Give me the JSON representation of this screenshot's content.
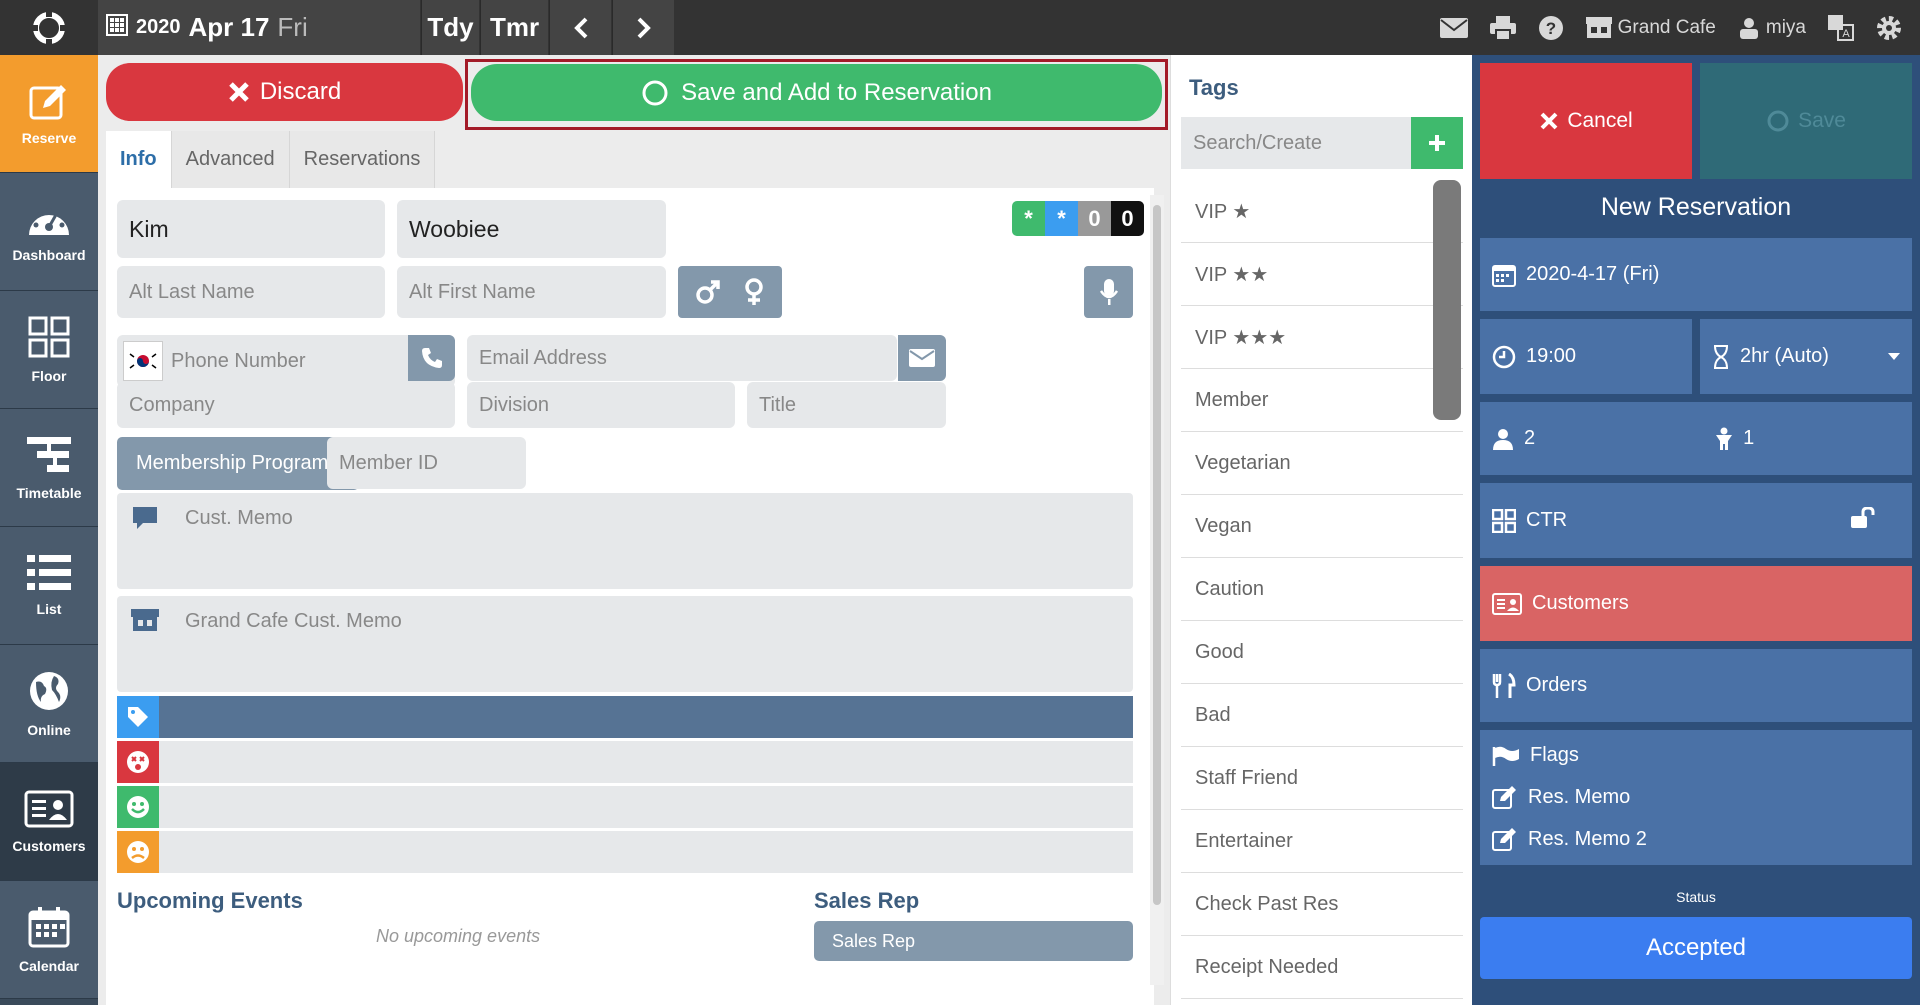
{
  "topbar": {
    "year": "2020",
    "month_day": "Apr 17",
    "weekday": "Fri",
    "today_label": "Tdy",
    "tomorrow_label": "Tmr",
    "restaurant": "Grand Cafe",
    "user": "miya"
  },
  "sidebar": {
    "items": [
      {
        "label": "Reserve",
        "icon": "edit-icon"
      },
      {
        "label": "Dashboard",
        "icon": "dashboard-icon"
      },
      {
        "label": "Floor",
        "icon": "floor-icon"
      },
      {
        "label": "Timetable",
        "icon": "timetable-icon"
      },
      {
        "label": "List",
        "icon": "list-icon"
      },
      {
        "label": "Online",
        "icon": "globe-icon"
      },
      {
        "label": "Customers",
        "icon": "customers-icon"
      },
      {
        "label": "Calendar",
        "icon": "calendar-icon"
      }
    ]
  },
  "actions": {
    "discard": "Discard",
    "save_add": "Save and Add to Reservation"
  },
  "tabs": [
    "Info",
    "Advanced",
    "Reservations"
  ],
  "form": {
    "last_name": "Kim",
    "first_name": "Woobiee",
    "alt_last_name": "Alt Last Name",
    "alt_first_name": "Alt First Name",
    "phone": "Phone Number",
    "email": "Email Address",
    "company": "Company",
    "division": "Division",
    "title": "Title",
    "membership_program": "Membership Program",
    "member_id": "Member ID",
    "cust_memo": "Cust. Memo",
    "venue_cust_memo": "Grand Cafe Cust. Memo",
    "badges": [
      "*",
      "*",
      "0",
      "0"
    ],
    "upcoming_events_title": "Upcoming Events",
    "no_upcoming": "No upcoming events",
    "sales_rep_title": "Sales Rep",
    "sales_rep_placeholder": "Sales Rep"
  },
  "tags": {
    "title": "Tags",
    "search_placeholder": "Search/Create",
    "items": [
      "VIP ★",
      "VIP ★★",
      "VIP ★★★",
      "Member",
      "Vegetarian",
      "Vegan",
      "Caution",
      "Good",
      "Bad",
      "Staff Friend",
      "Entertainer",
      "Check Past Res",
      "Receipt Needed"
    ]
  },
  "reservation": {
    "cancel": "Cancel",
    "save": "Save",
    "title": "New Reservation",
    "date": "2020-4-17 (Fri)",
    "time": "19:00",
    "duration": "2hr (Auto)",
    "adults": "2",
    "children": "1",
    "table": "CTR",
    "customers": "Customers",
    "orders": "Orders",
    "flags": "Flags",
    "res_memo": "Res. Memo",
    "res_memo2": "Res. Memo 2",
    "status_label": "Status",
    "status": "Accepted"
  },
  "colors": {
    "discard": "#d9373f",
    "save_add": "#3fba6d",
    "accent_orange": "#f39c2d",
    "right_panel": "#2e4f7a",
    "accepted": "#3b7df0"
  }
}
